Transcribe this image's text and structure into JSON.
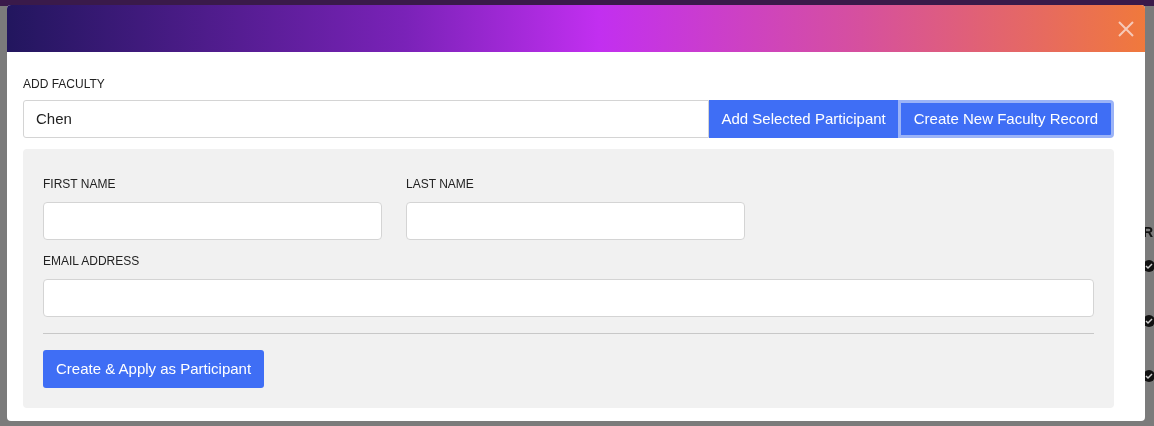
{
  "background": {
    "column_header": "R",
    "rows": [
      {
        "checked": true
      },
      {
        "checked": true
      },
      {
        "checked": true
      }
    ]
  },
  "modal": {
    "search": {
      "label": "ADD FACULTY",
      "value": "Chen"
    },
    "buttons": [
      {
        "label": "Add Selected Participant",
        "focused": false
      },
      {
        "label": "Create New Faculty Record",
        "focused": true
      }
    ],
    "form": {
      "fields": [
        {
          "label": "FIRST NAME",
          "kind": "short"
        },
        {
          "label": "LAST NAME",
          "kind": "short"
        },
        {
          "label": "EMAIL ADDRESS",
          "kind": "long"
        }
      ],
      "submit": "Create & Apply as Participant"
    }
  }
}
